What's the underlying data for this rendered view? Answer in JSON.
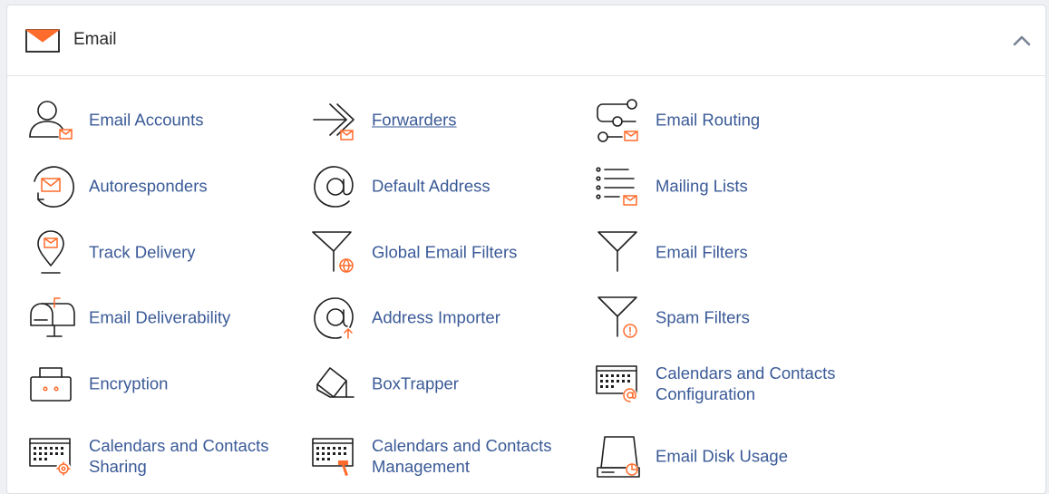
{
  "section": {
    "title": "Email",
    "accent_color": "#ff6c2c",
    "link_color": "#3a5a97"
  },
  "tools": [
    {
      "label": "Email Accounts",
      "icon": "email-accounts-icon"
    },
    {
      "label": "Forwarders",
      "icon": "forwarders-icon"
    },
    {
      "label": "Email Routing",
      "icon": "email-routing-icon"
    },
    {
      "label": "Autoresponders",
      "icon": "autoresponders-icon"
    },
    {
      "label": "Default Address",
      "icon": "default-address-icon"
    },
    {
      "label": "Mailing Lists",
      "icon": "mailing-lists-icon"
    },
    {
      "label": "Track Delivery",
      "icon": "track-delivery-icon"
    },
    {
      "label": "Global Email Filters",
      "icon": "global-email-filters-icon"
    },
    {
      "label": "Email Filters",
      "icon": "email-filters-icon"
    },
    {
      "label": "Email Deliverability",
      "icon": "email-deliverability-icon"
    },
    {
      "label": "Address Importer",
      "icon": "address-importer-icon"
    },
    {
      "label": "Spam Filters",
      "icon": "spam-filters-icon"
    },
    {
      "label": "Encryption",
      "icon": "encryption-icon"
    },
    {
      "label": "BoxTrapper",
      "icon": "boxtrapper-icon"
    },
    {
      "label": "Calendars and Contacts Configuration",
      "icon": "calendars-contacts-configuration-icon"
    },
    {
      "label": "Calendars and Contacts Sharing",
      "icon": "calendars-contacts-sharing-icon"
    },
    {
      "label": "Calendars and Contacts Management",
      "icon": "calendars-contacts-management-icon"
    },
    {
      "label": "Email Disk Usage",
      "icon": "email-disk-usage-icon"
    }
  ]
}
